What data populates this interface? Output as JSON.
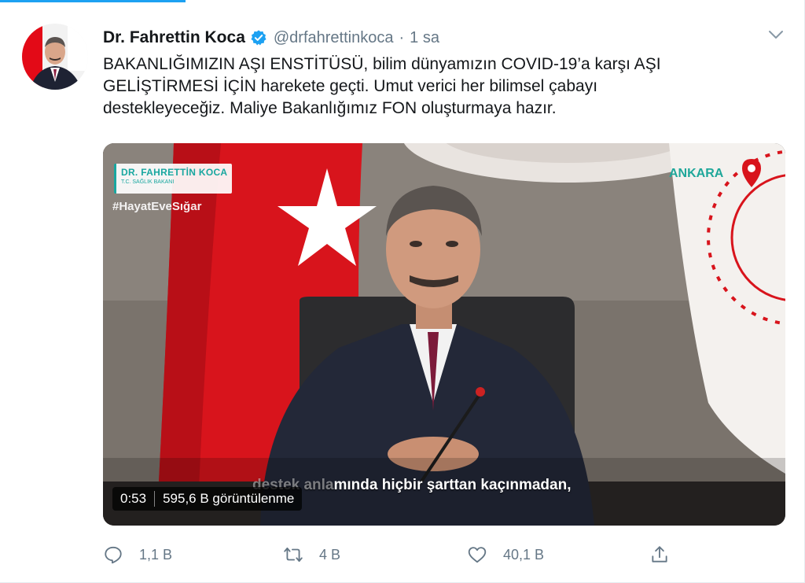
{
  "tweet": {
    "author_name": "Dr. Fahrettin Koca",
    "handle": "@drfahrettinkoca",
    "separator": "·",
    "time": "1 sa",
    "lines": [
      "BAKANLIĞIMIZIN AŞI ENSTİTÜSÜ, bilim dünyamızın COVID-19’a karşı AŞI",
      "GELİŞTİRMESİ İÇİN harekete geçti. Umut verici her bilimsel çabayı",
      "destekleyeceğiz. Maliye Bakanlığımız FON oluşturmaya hazır."
    ]
  },
  "video": {
    "chyron_name": "DR. FAHRETTİN KOCA",
    "chyron_title": "T.C. SAĞLIK BAKANI",
    "hashtag": "#HayatEveSığar",
    "location": "ANKARA",
    "subtitle_faded": "destek anla",
    "subtitle": "mında hiçbir şarttan kaçınmadan,",
    "duration": "0:53",
    "views": "595,6 B görüntülenme"
  },
  "actions": {
    "reply_count": "1,1 B",
    "retweet_count": "4 B",
    "like_count": "40,1 B"
  },
  "icons": {
    "verified": "verified-badge-icon",
    "caret": "chevron-down-icon",
    "reply": "reply-icon",
    "retweet": "retweet-icon",
    "like": "heart-icon",
    "share": "share-icon"
  },
  "colors": {
    "accent": "#1da1f2",
    "text": "#14171a",
    "secondary": "#657786",
    "flag_red": "#e30a17",
    "chyron_teal": "#19a7a0"
  }
}
